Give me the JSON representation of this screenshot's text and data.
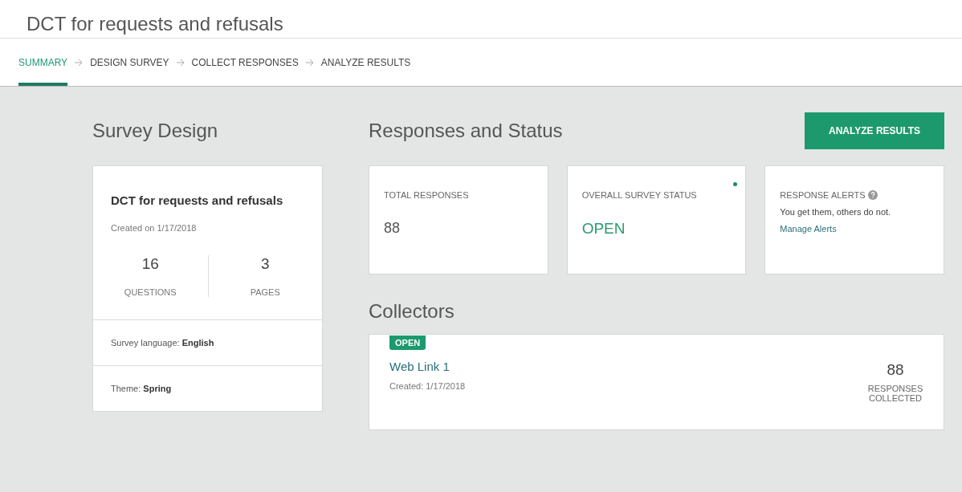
{
  "page_title": "DCT for requests and refusals",
  "tabs": [
    {
      "label": "SUMMARY",
      "selected": true
    },
    {
      "label": "DESIGN SURVEY",
      "selected": false
    },
    {
      "label": "COLLECT RESPONSES",
      "selected": false
    },
    {
      "label": "ANALYZE RESULTS",
      "selected": false
    }
  ],
  "survey_design": {
    "heading": "Survey Design",
    "name": "DCT for requests and refusals",
    "created": "Created on 1/17/2018",
    "stats": [
      {
        "value": "16",
        "label": "QUESTIONS"
      },
      {
        "value": "3",
        "label": "PAGES"
      }
    ],
    "details": [
      {
        "label": "Survey language: ",
        "value": "English"
      },
      {
        "label": "Theme: ",
        "value": "Spring"
      }
    ]
  },
  "responses": {
    "heading": "Responses and Status",
    "button": "ANALYZE RESULTS",
    "cards": [
      {
        "kind": "number",
        "label": "TOTAL RESPONSES",
        "value": "88"
      },
      {
        "kind": "status",
        "label": "OVERALL SURVEY STATUS",
        "value": "OPEN",
        "indicator": true
      },
      {
        "kind": "alerts",
        "label": "RESPONSE ALERTS",
        "text": "You get them, others do not.",
        "link": "Manage Alerts"
      }
    ]
  },
  "collectors": {
    "heading": "Collectors",
    "items": [
      {
        "badge": "OPEN",
        "name": "Web Link 1",
        "created": "Created: 1/17/2018",
        "count": "88",
        "count_label": "RESPONSES COLLECTED"
      }
    ]
  }
}
